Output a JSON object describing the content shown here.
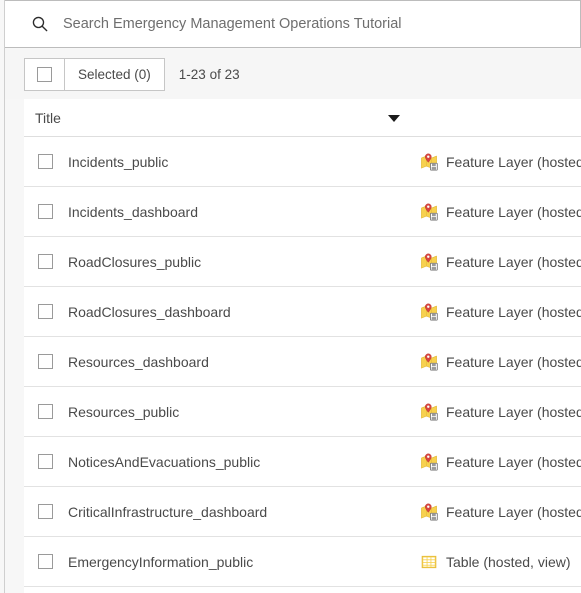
{
  "search": {
    "icon": "search-icon",
    "value": "",
    "placeholder": "Search Emergency Management Operations Tutorial"
  },
  "toolbar": {
    "select_all_icon": "checkbox-unchecked-icon",
    "selected_label": "Selected (0)",
    "count_label": "1-23 of 23"
  },
  "sort_header": {
    "label": "Title",
    "caret_icon": "chevron-down-icon"
  },
  "items": [
    {
      "title": "Incidents_public",
      "checkbox_icon": "checkbox-unchecked-icon",
      "type_icon": "feature-layer-icon",
      "type_label": "Feature Layer (hosted"
    },
    {
      "title": "Incidents_dashboard",
      "checkbox_icon": "checkbox-unchecked-icon",
      "type_icon": "feature-layer-icon",
      "type_label": "Feature Layer (hosted"
    },
    {
      "title": "RoadClosures_public",
      "checkbox_icon": "checkbox-unchecked-icon",
      "type_icon": "feature-layer-icon",
      "type_label": "Feature Layer (hosted"
    },
    {
      "title": "RoadClosures_dashboard",
      "checkbox_icon": "checkbox-unchecked-icon",
      "type_icon": "feature-layer-icon",
      "type_label": "Feature Layer (hosted"
    },
    {
      "title": "Resources_dashboard",
      "checkbox_icon": "checkbox-unchecked-icon",
      "type_icon": "feature-layer-icon",
      "type_label": "Feature Layer (hosted"
    },
    {
      "title": "Resources_public",
      "checkbox_icon": "checkbox-unchecked-icon",
      "type_icon": "feature-layer-icon",
      "type_label": "Feature Layer (hosted"
    },
    {
      "title": "NoticesAndEvacuations_public",
      "checkbox_icon": "checkbox-unchecked-icon",
      "type_icon": "feature-layer-icon",
      "type_label": "Feature Layer (hosted"
    },
    {
      "title": "CriticalInfrastructure_dashboard",
      "checkbox_icon": "checkbox-unchecked-icon",
      "type_icon": "feature-layer-icon",
      "type_label": "Feature Layer (hosted"
    },
    {
      "title": "EmergencyInformation_public",
      "checkbox_icon": "checkbox-unchecked-icon",
      "type_icon": "table-icon",
      "type_label": "Table (hosted, view)"
    }
  ],
  "colors": {
    "page_background": "#f7f7f7",
    "panel_background": "#ffffff",
    "text": "#4a4a4a",
    "divider": "#e2e2e2",
    "border": "#c6c6c6",
    "icon_map_yellow": "#f5cf47",
    "icon_pin_red": "#d9453d",
    "icon_table_yellow": "#f5cf47"
  }
}
